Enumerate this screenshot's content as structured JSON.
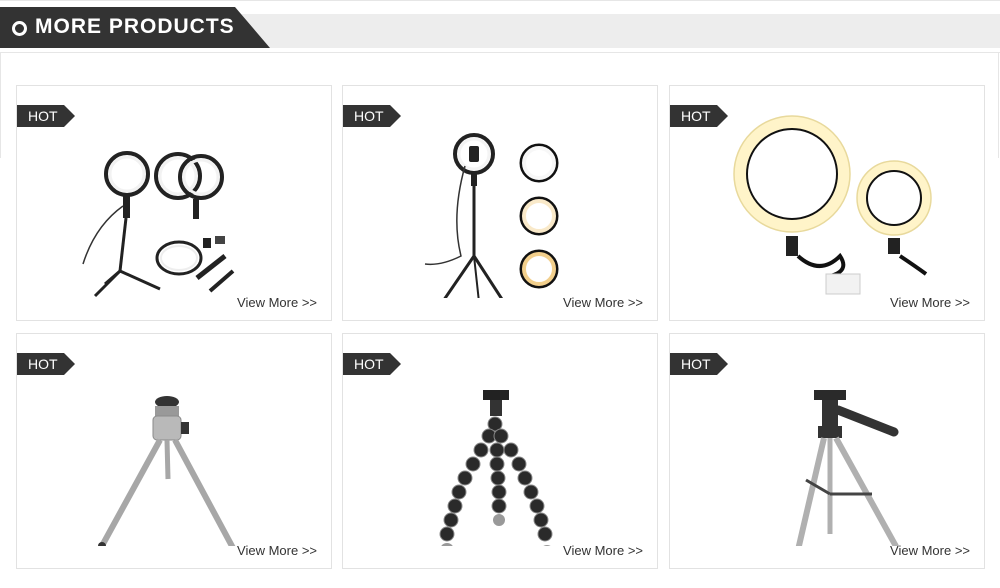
{
  "header": {
    "title": "MORE PRODUCTS",
    "icon": "circle-outline-icon"
  },
  "products": [
    {
      "badge": "HOT",
      "link_label": "View More >>",
      "image": "ring-light-tripod-kit-image"
    },
    {
      "badge": "HOT",
      "link_label": "View More >>",
      "image": "ring-light-stand-three-colors-image"
    },
    {
      "badge": "HOT",
      "link_label": "View More >>",
      "image": "two-ring-lights-image"
    },
    {
      "badge": "HOT",
      "link_label": "View More >>",
      "image": "mini-silver-tripod-image"
    },
    {
      "badge": "HOT",
      "link_label": "View More >>",
      "image": "flexible-octopus-tripod-image"
    },
    {
      "badge": "HOT",
      "link_label": "View More >>",
      "image": "aluminum-camera-tripod-image"
    }
  ],
  "colors": {
    "header_dark": "#333333",
    "header_strip": "#ededed",
    "border": "#e2e2e2",
    "ring_warm": "#fff2c8"
  }
}
